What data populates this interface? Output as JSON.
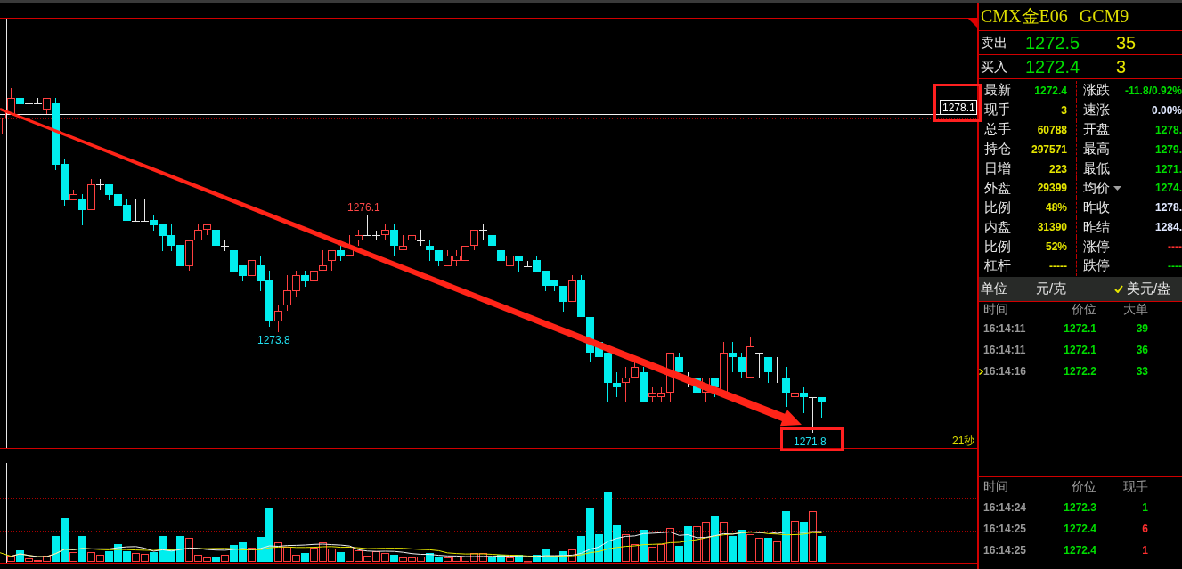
{
  "chart": {
    "price_tag": "1278.1",
    "high_label": "1276.1",
    "low_label": "1273.8",
    "recent_low_label": "1271.8",
    "countdown": "21秒"
  },
  "quote": {
    "name": "CMX金E06",
    "code": "GCM9",
    "ask": {
      "label": "卖出",
      "price": "1272.5",
      "volume": "35"
    },
    "bid": {
      "label": "买入",
      "price": "1272.4",
      "volume": "3"
    },
    "stats": [
      {
        "label": "最新",
        "value": "1272.4",
        "color": "#00dd00",
        "kind": "plain"
      },
      {
        "label": "涨跌",
        "value": "-11.8/0.92%",
        "color": "#00dd00",
        "kind": "plain"
      },
      {
        "label": "现手",
        "value": "3",
        "color": "#e6e600",
        "kind": "plain"
      },
      {
        "label": "速涨",
        "value": "0.00%",
        "color": "#e0e8ff",
        "kind": "plain"
      },
      {
        "label": "总手",
        "value": "60788",
        "color": "#e6e600",
        "kind": "plain"
      },
      {
        "label": "开盘",
        "value": "1278.",
        "color": "#00dd00",
        "kind": "plain"
      },
      {
        "label": "持仓",
        "value": "297571",
        "color": "#e6e600",
        "kind": "plain"
      },
      {
        "label": "最高",
        "value": "1279.",
        "color": "#00dd00",
        "kind": "plain"
      },
      {
        "label": "日增",
        "value": "223",
        "color": "#e6e600",
        "kind": "plain"
      },
      {
        "label": "最低",
        "value": "1271.",
        "color": "#00dd00",
        "kind": "plain"
      },
      {
        "label": "外盘",
        "value": "29399",
        "color": "#e6e600",
        "kind": "plain"
      },
      {
        "label": "均价",
        "value": "1274.",
        "color": "#00dd00",
        "kind": "dropdown"
      },
      {
        "label": "比例",
        "value": "48%",
        "color": "#e6e600",
        "kind": "plain"
      },
      {
        "label": "昨收",
        "value": "1278.",
        "color": "#e0e8ff",
        "kind": "plain"
      },
      {
        "label": "内盘",
        "value": "31390",
        "color": "#e6e600",
        "kind": "plain"
      },
      {
        "label": "昨结",
        "value": "1284.",
        "color": "#e0e8ff",
        "kind": "plain"
      },
      {
        "label": "比例",
        "value": "52%",
        "color": "#e6e600",
        "kind": "plain"
      },
      {
        "label": "涨停",
        "value": "----",
        "color": "#ff3030",
        "kind": "plain"
      },
      {
        "label": "杠杆",
        "value": "-----",
        "color": "#e6e600",
        "kind": "plain"
      },
      {
        "label": "跌停",
        "value": "----",
        "color": "#00dd00",
        "kind": "plain"
      }
    ],
    "units": {
      "label": "单位",
      "options": [
        {
          "label": "元/克",
          "checked": false
        },
        {
          "label": "美元/盎",
          "checked": true
        }
      ]
    }
  },
  "big_orders": {
    "columns": [
      "时间",
      "价位",
      "大单"
    ],
    "rows": [
      {
        "time": "16:14:11",
        "price": "1272.1",
        "volume": "39",
        "selected": false
      },
      {
        "time": "16:14:11",
        "price": "1272.1",
        "volume": "36",
        "selected": false
      },
      {
        "time": "16:14:16",
        "price": "1272.2",
        "volume": "33",
        "selected": true
      }
    ]
  },
  "ticks": {
    "columns": [
      "时间",
      "价位",
      "现手"
    ],
    "rows": [
      {
        "time": "16:14:24",
        "price": "1272.3",
        "volume": "1",
        "color": "#00dd00"
      },
      {
        "time": "16:14:25",
        "price": "1272.4",
        "volume": "6",
        "color": "#ff3030"
      },
      {
        "time": "16:14:25",
        "price": "1272.4",
        "volume": "1",
        "color": "#ff3030"
      }
    ]
  }
}
